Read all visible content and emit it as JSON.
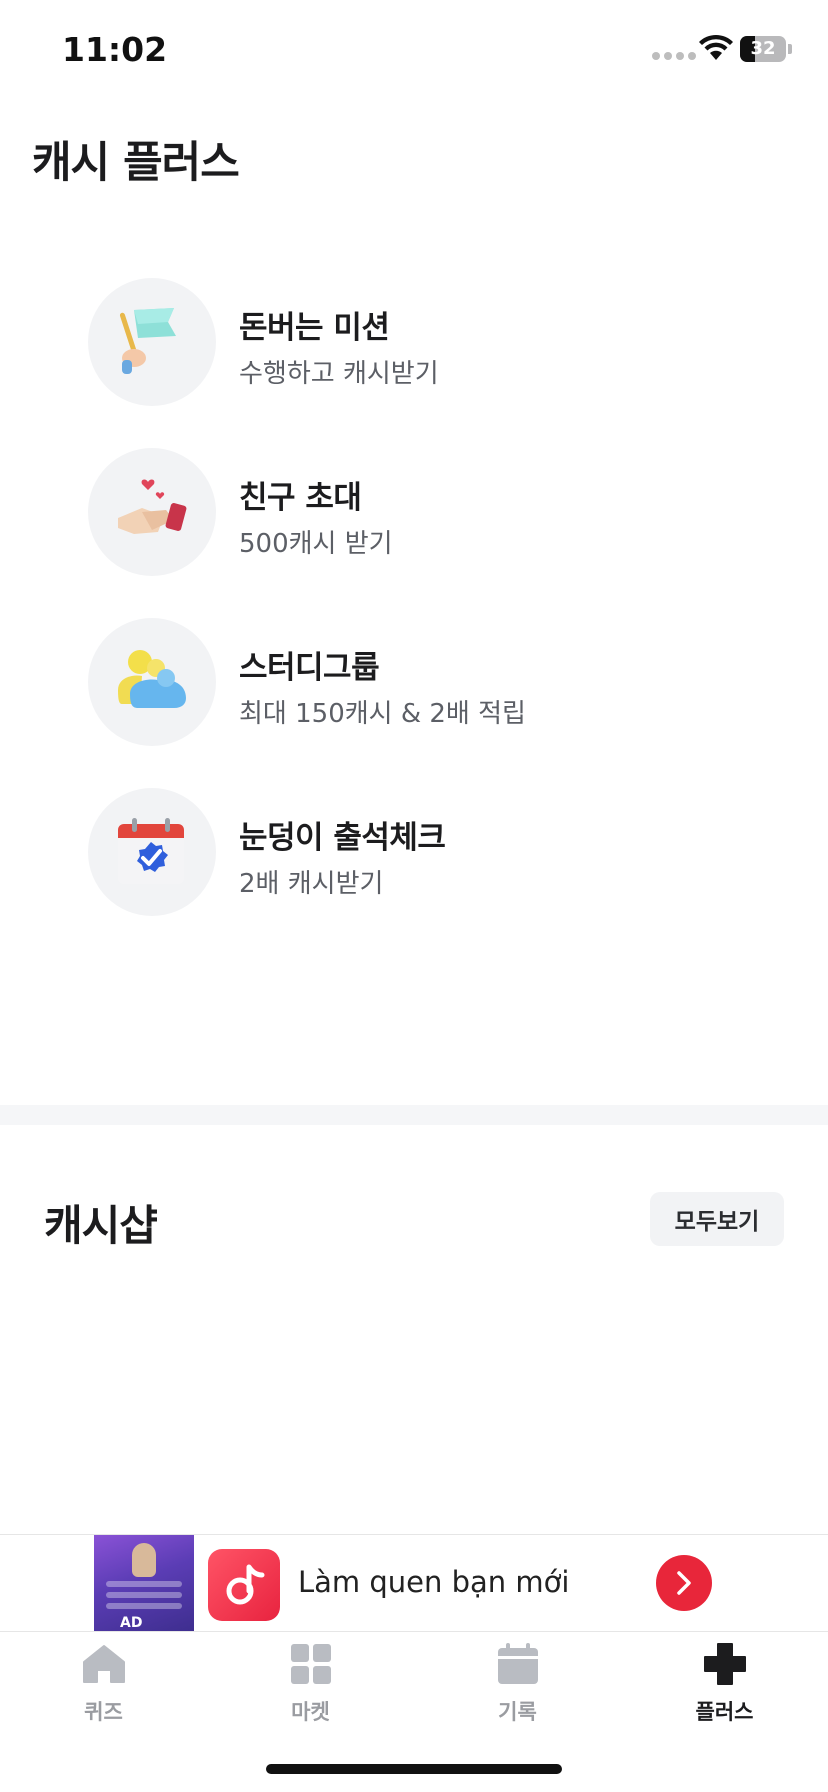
{
  "status_bar": {
    "time": "11:02",
    "battery": "32",
    "battery_level": 0.32
  },
  "page": {
    "title": "캐시 플러스"
  },
  "menu": {
    "items": [
      {
        "title": "돈버는 미션",
        "subtitle": "수행하고 캐시받기",
        "icon": "flag-hand-icon"
      },
      {
        "title": "친구 초대",
        "subtitle": "500캐시 받기",
        "icon": "handshake-hearts-icon"
      },
      {
        "title": "스터디그룹",
        "subtitle": "최대 150캐시 & 2배 적립",
        "icon": "group-people-icon"
      },
      {
        "title": "눈덩이 출석체크",
        "subtitle": "2배 캐시받기",
        "icon": "calendar-check-icon"
      }
    ]
  },
  "shop": {
    "title": "캐시샵",
    "view_all": "모두보기"
  },
  "ad": {
    "text": "Làm quen bạn mới",
    "label": "AD",
    "accent": "#e8263a"
  },
  "tabs": [
    {
      "label": "퀴즈",
      "icon": "home-icon",
      "active": false
    },
    {
      "label": "마켓",
      "icon": "grid-icon",
      "active": false
    },
    {
      "label": "기록",
      "icon": "calendar-icon",
      "active": false
    },
    {
      "label": "플러스",
      "icon": "plus-icon",
      "active": true
    }
  ]
}
